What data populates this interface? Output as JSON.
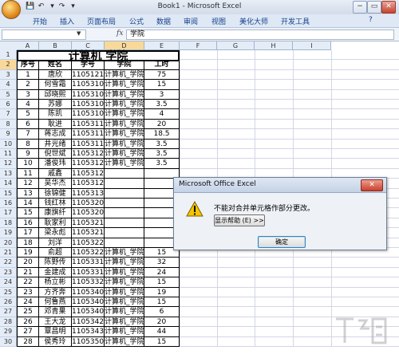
{
  "window": {
    "title": "Book1 - Microsoft Excel",
    "minimize": "−",
    "maximize": "▭",
    "close": "✕"
  },
  "ribbon": {
    "tabs": [
      "开始",
      "插入",
      "页面布局",
      "公式",
      "数据",
      "审阅",
      "视图",
      "美化大师",
      "开发工具"
    ]
  },
  "formula_bar": {
    "name_box": "",
    "fx": "fx",
    "value": "学院"
  },
  "columns": [
    "A",
    "B",
    "C",
    "D",
    "E",
    "F",
    "G",
    "H",
    "I"
  ],
  "rows": [
    "1",
    "2",
    "3",
    "4",
    "5",
    "6",
    "7",
    "8",
    "9",
    "10",
    "11",
    "12",
    "13",
    "14",
    "15",
    "16",
    "17",
    "18",
    "19",
    "20",
    "21",
    "22",
    "23",
    "24",
    "25",
    "26",
    "27",
    "28",
    "29",
    "30"
  ],
  "sheet": {
    "title": "计算机  学院",
    "headers": [
      "序号",
      "姓名",
      "学号",
      "学院",
      "工时"
    ],
    "data": [
      [
        "1",
        "唐欣",
        "11051218",
        "计算机_学院",
        "75"
      ],
      [
        "2",
        "何雪霜",
        "11053102",
        "计算机_学院",
        "15"
      ],
      [
        "3",
        "邱晓熙",
        "11053104",
        "计算机_学院",
        "3"
      ],
      [
        "4",
        "苏娜",
        "11053105",
        "计算机_学院",
        "3.5"
      ],
      [
        "5",
        "陈凯",
        "11053108",
        "计算机_学院",
        "4"
      ],
      [
        "6",
        "耿进",
        "11053110",
        "计算机_学院",
        "20"
      ],
      [
        "7",
        "蒋志成",
        "11053114",
        "计算机_学院",
        "18.5"
      ],
      [
        "8",
        "井光绪",
        "11053115",
        "计算机_学院",
        "3.5"
      ],
      [
        "9",
        "倪世斌",
        "11053120",
        "计算机_学院",
        "3.5"
      ],
      [
        "10",
        "潘俊玮",
        "11053122",
        "计算机_学院",
        "3.5"
      ],
      [
        "11",
        "戚鑫",
        "11053124",
        "",
        ""
      ],
      [
        "12",
        "吴华杰",
        "11053128",
        "",
        ""
      ],
      [
        "13",
        "徐锦健",
        "11053130",
        "",
        ""
      ],
      [
        "14",
        "钱红林",
        "11053203",
        "",
        ""
      ],
      [
        "15",
        "康旗纤",
        "11053205",
        "",
        ""
      ],
      [
        "16",
        "耿家利",
        "11053212",
        "",
        ""
      ],
      [
        "17",
        "梁永彪",
        "11053219",
        "",
        ""
      ],
      [
        "18",
        "刘洋",
        "11053222",
        "",
        ""
      ],
      [
        "19",
        "俞超",
        "11053226",
        "计算机_学院",
        "15"
      ],
      [
        "20",
        "陈野传",
        "11053310",
        "计算机_学院",
        "32"
      ],
      [
        "21",
        "金建成",
        "11053316",
        "计算机_学院",
        "24"
      ],
      [
        "22",
        "杨立彬",
        "11053324",
        "计算机_学院",
        "15"
      ],
      [
        "23",
        "方齐奔",
        "11053402",
        "计算机_学院",
        "19"
      ],
      [
        "24",
        "何鲁燕",
        "11053403",
        "计算机_学院",
        "15"
      ],
      [
        "25",
        "邓青果",
        "11053408",
        "计算机_学院",
        "6"
      ],
      [
        "26",
        "王大龙",
        "11053424",
        "计算机_学院",
        "20"
      ],
      [
        "27",
        "覃昌明",
        "11053435",
        "计算机_学院",
        "44"
      ],
      [
        "28",
        "侯秀玲",
        "11053503",
        "计算机_学院",
        "15"
      ]
    ]
  },
  "dialog": {
    "title": "Microsoft Office Excel",
    "close": "✕",
    "message": "不能对合并单元格作部分更改。",
    "help_button": "显示帮助 (E) >>",
    "ok_button": "确定",
    "icon": "warning-icon"
  },
  "colors": {
    "ribbon_bg": "#dfe8f5",
    "header_bg": "#e4ecf7",
    "selected_header": "#f9d99a",
    "dialog_bg": "#eef1f6"
  }
}
